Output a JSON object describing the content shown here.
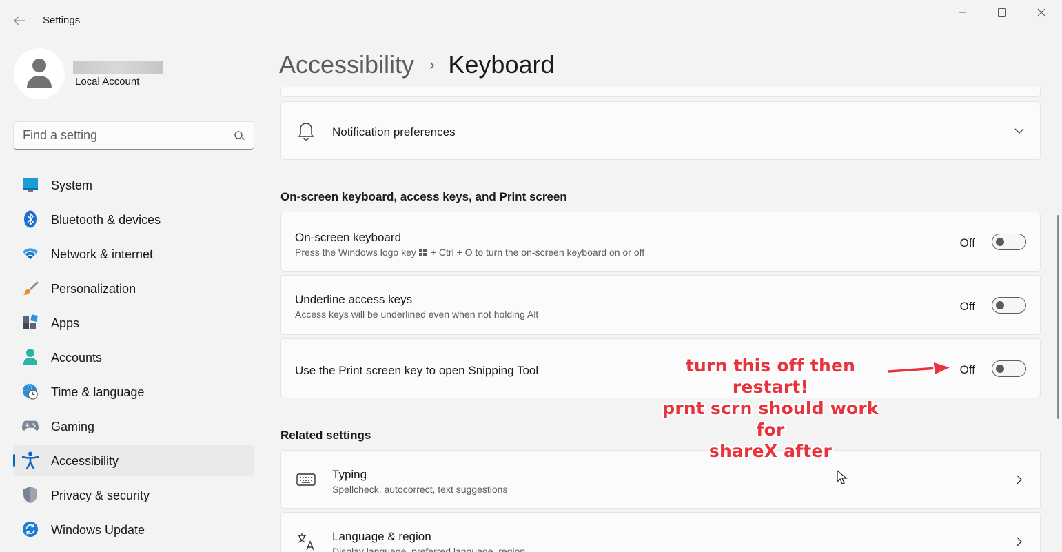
{
  "window": {
    "title": "Settings",
    "icons": {
      "back": "back-arrow-icon",
      "minimize": "minimize-icon",
      "maximize": "maximize-icon",
      "close": "close-icon"
    }
  },
  "account": {
    "type": "Local Account"
  },
  "search": {
    "placeholder": "Find a setting"
  },
  "sidebar": {
    "items": [
      {
        "label": "System",
        "icon": "system-monitor-icon"
      },
      {
        "label": "Bluetooth & devices",
        "icon": "bluetooth-icon"
      },
      {
        "label": "Network & internet",
        "icon": "wifi-icon"
      },
      {
        "label": "Personalization",
        "icon": "paintbrush-icon"
      },
      {
        "label": "Apps",
        "icon": "apps-icon"
      },
      {
        "label": "Accounts",
        "icon": "person-icon"
      },
      {
        "label": "Time & language",
        "icon": "globe-clock-icon"
      },
      {
        "label": "Gaming",
        "icon": "gamepad-icon"
      },
      {
        "label": "Accessibility",
        "icon": "accessibility-icon",
        "active": true
      },
      {
        "label": "Privacy & security",
        "icon": "shield-icon"
      },
      {
        "label": "Windows Update",
        "icon": "update-sync-icon"
      }
    ]
  },
  "breadcrumb": {
    "parent": "Accessibility",
    "separator": "›",
    "current": "Keyboard"
  },
  "notification_card": {
    "title": "Notification preferences"
  },
  "onscreen_section": {
    "header": "On-screen keyboard, access keys, and Print screen",
    "items": [
      {
        "title": "On-screen keyboard",
        "desc_before": "Press the Windows logo key",
        "desc_after": "+ Ctrl + O to turn the on-screen keyboard on or off",
        "state": "Off"
      },
      {
        "title": "Underline access keys",
        "desc": "Access keys will be underlined even when not holding Alt",
        "state": "Off"
      },
      {
        "title": "Use the Print screen key to open Snipping Tool",
        "state": "Off"
      }
    ]
  },
  "related_section": {
    "header": "Related settings",
    "items": [
      {
        "title": "Typing",
        "desc": "Spellcheck, autocorrect, text suggestions",
        "icon": "keyboard-icon"
      },
      {
        "title": "Language & region",
        "desc": "Display language, preferred language, region",
        "icon": "language-icon"
      }
    ]
  },
  "annotation": {
    "lines": [
      "turn this off then restart!",
      "prnt scrn should work for",
      "shareX after"
    ],
    "color": "#e8323c"
  },
  "colors": {
    "accent": "#0067c0",
    "background": "#f3f3f3",
    "card": "#fbfbfb"
  }
}
